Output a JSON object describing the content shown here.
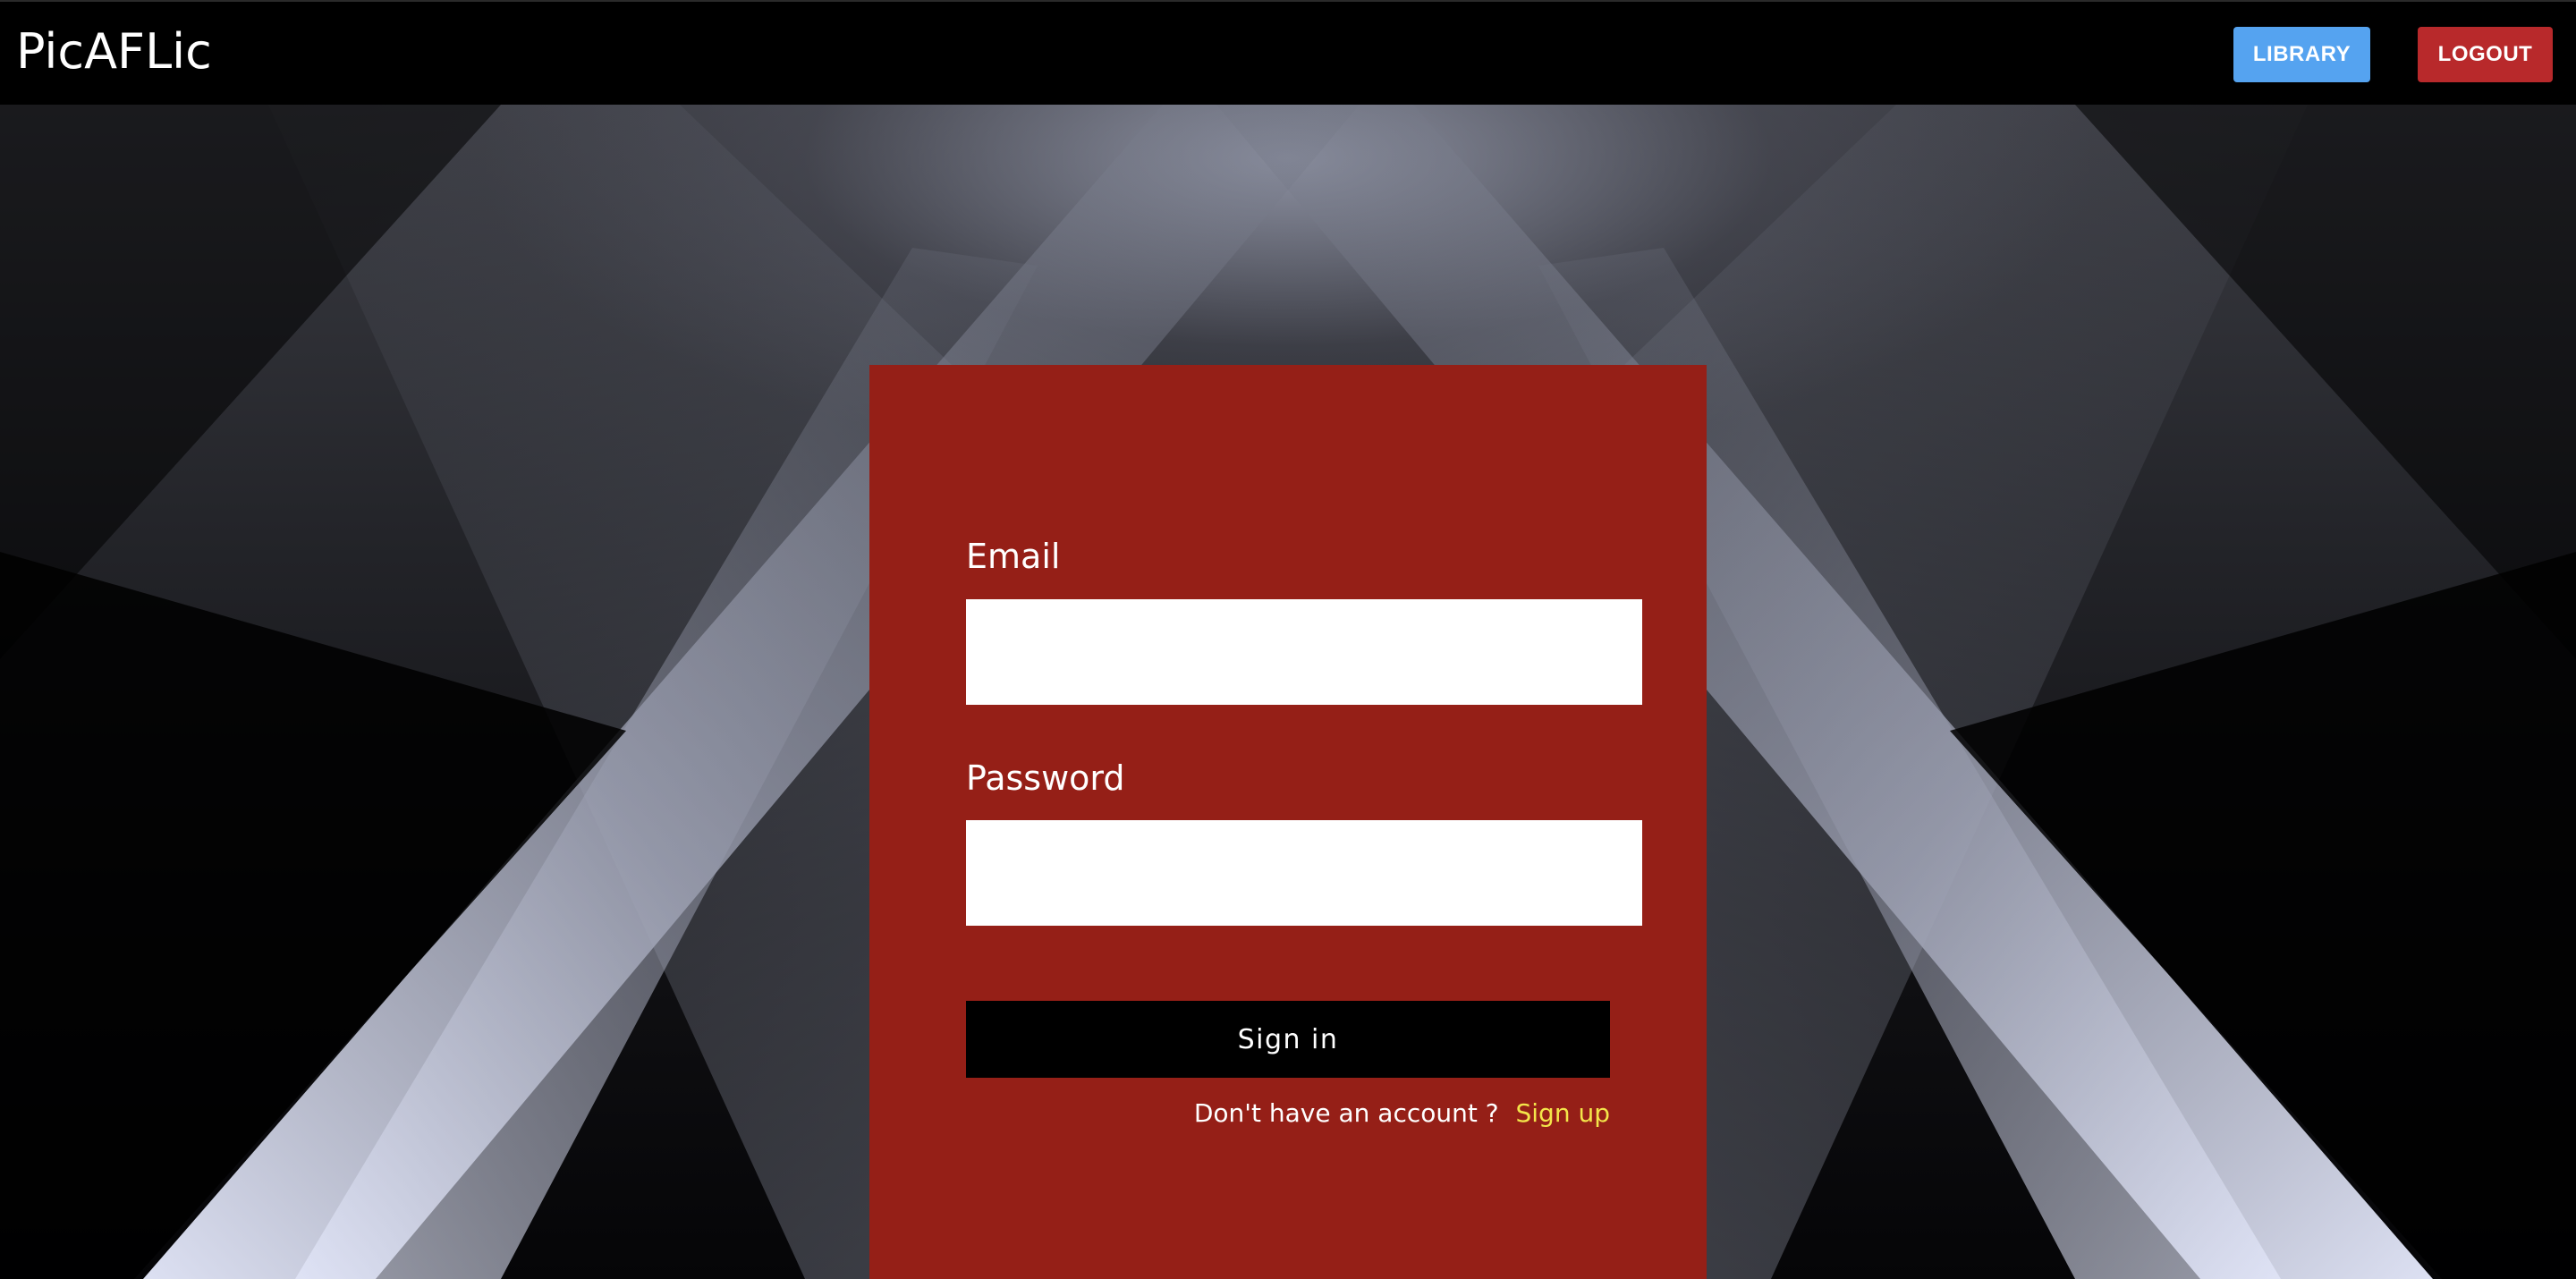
{
  "header": {
    "brand": "PicAFLic",
    "library_label": "LIBRARY",
    "logout_label": "LOGOUT"
  },
  "login_form": {
    "email_label": "Email",
    "email_value": "",
    "password_label": "Password",
    "password_value": "",
    "signin_label": "Sign in",
    "no_account_text": "Don't have an account ?",
    "signup_label": "Sign up"
  },
  "colors": {
    "library_button": "#55a3f0",
    "logout_button": "#b8292b",
    "card_background": "#951f17",
    "signup_link": "#f3e54a",
    "signin_button": "#000000"
  }
}
